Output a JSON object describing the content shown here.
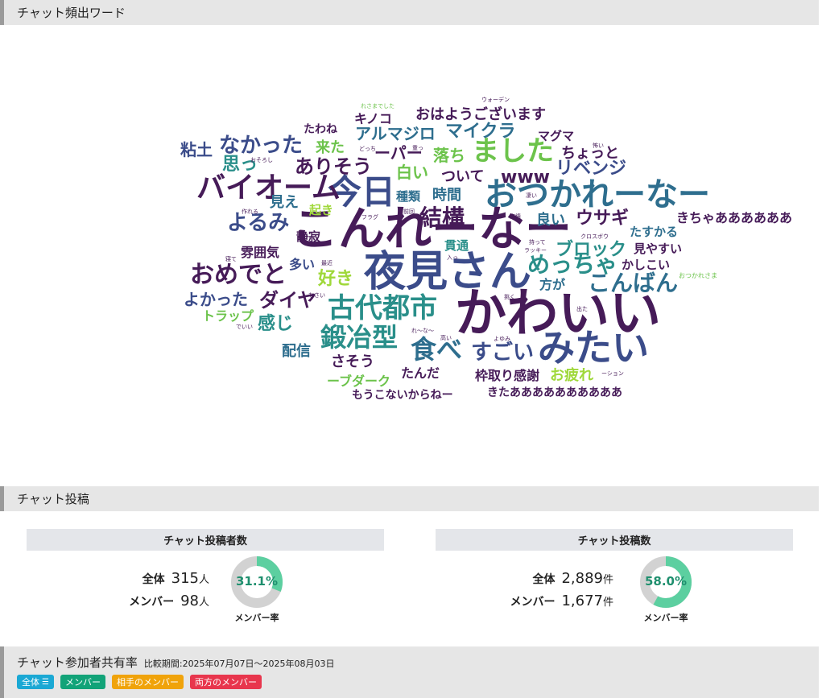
{
  "wordcloud_section": {
    "title": "チャット頻出ワード",
    "words": [
      {
        "text": "かわいい",
        "color": "#461b58"
      },
      {
        "text": "こんれーなー",
        "color": "#461b58"
      },
      {
        "text": "夜見さん",
        "color": "#3b4c8a"
      },
      {
        "text": "おつかれーなー",
        "color": "#2e6e8e"
      },
      {
        "text": "今日",
        "color": "#3b4c8a"
      },
      {
        "text": "みたい",
        "color": "#3b4c8a"
      },
      {
        "text": "古代都市",
        "color": "#2a8f8a"
      },
      {
        "text": "バイオーム",
        "color": "#461b58"
      },
      {
        "text": "ました",
        "color": "#6cc34b"
      },
      {
        "text": "鍛冶型",
        "color": "#2a8f8a"
      },
      {
        "text": "食べ",
        "color": "#2e6e8e"
      },
      {
        "text": "おめでと",
        "color": "#461b58"
      },
      {
        "text": "結構",
        "color": "#461b58"
      },
      {
        "text": "めっちゃ",
        "color": "#2a8f8a"
      },
      {
        "text": "こんばん",
        "color": "#2e6e8e"
      },
      {
        "text": "すごい",
        "color": "#3b4c8a"
      },
      {
        "text": "なかった",
        "color": "#3b4c8a"
      },
      {
        "text": "よるみ",
        "color": "#3b4c8a"
      },
      {
        "text": "ありそう",
        "color": "#461b58"
      },
      {
        "text": "ダイヤ",
        "color": "#461b58"
      },
      {
        "text": "ブロック",
        "color": "#2a8f8a"
      },
      {
        "text": "リベンジ",
        "color": "#3b4c8a"
      },
      {
        "text": "ウサギ",
        "color": "#461b58"
      },
      {
        "text": "マイクラ",
        "color": "#2e6e8e"
      },
      {
        "text": "アルマジロ",
        "color": "#2e6e8e"
      },
      {
        "text": "おはようございます",
        "color": "#461b58"
      },
      {
        "text": "きちゃああああああ",
        "color": "#461b58"
      },
      {
        "text": "よかった",
        "color": "#3b4c8a"
      },
      {
        "text": "思っ",
        "color": "#2a8f8a"
      },
      {
        "text": "白い",
        "color": "#6cc34b"
      },
      {
        "text": "落ち",
        "color": "#6cc34b"
      },
      {
        "text": "ついて",
        "color": "#461b58"
      },
      {
        "text": "www",
        "color": "#461b58"
      },
      {
        "text": "粘土",
        "color": "#3b4c8a"
      },
      {
        "text": "来た",
        "color": "#6cc34b"
      },
      {
        "text": "ーパー",
        "color": "#461b58"
      },
      {
        "text": "ちょっと",
        "color": "#461b58"
      },
      {
        "text": "時間",
        "color": "#2e6e8e"
      },
      {
        "text": "見え",
        "color": "#2e6e8e"
      },
      {
        "text": "良い",
        "color": "#2e6e8e"
      },
      {
        "text": "好き",
        "color": "#9fd83a"
      },
      {
        "text": "雰囲気",
        "color": "#461b58"
      },
      {
        "text": "感じ",
        "color": "#2a8f8a"
      },
      {
        "text": "配信",
        "color": "#2e6e8e"
      },
      {
        "text": "さそう",
        "color": "#461b58"
      },
      {
        "text": "お疲れ",
        "color": "#9fd83a"
      },
      {
        "text": "枠取り感謝",
        "color": "#461b58"
      },
      {
        "text": "きたああああああああああ",
        "color": "#461b58"
      },
      {
        "text": "もうこないからねー",
        "color": "#461b58"
      },
      {
        "text": "ーブダーク",
        "color": "#6cc34b"
      },
      {
        "text": "たんだ",
        "color": "#461b58"
      },
      {
        "text": "トラップ",
        "color": "#6cc34b"
      },
      {
        "text": "多い",
        "color": "#3b4c8a"
      },
      {
        "text": "静寂",
        "color": "#461b58"
      },
      {
        "text": "貫通",
        "color": "#2a8f8a"
      },
      {
        "text": "方が",
        "color": "#2e6e8e"
      },
      {
        "text": "かしこい",
        "color": "#461b58"
      },
      {
        "text": "見やすい",
        "color": "#461b58"
      },
      {
        "text": "たすかる",
        "color": "#2e6e8e"
      },
      {
        "text": "マグマ",
        "color": "#461b58"
      },
      {
        "text": "キノコ",
        "color": "#461b58"
      },
      {
        "text": "たわね",
        "color": "#461b58"
      },
      {
        "text": "種類",
        "color": "#2e6e8e"
      },
      {
        "text": "起き",
        "color": "#9fd83a"
      },
      {
        "text": "おつかれさま",
        "color": "#6cc34b"
      },
      {
        "text": "れさまでした",
        "color": "#6cc34b"
      },
      {
        "text": "ウォーデン",
        "color": "#461b58"
      },
      {
        "text": "クロスボウ",
        "color": "#461b58"
      },
      {
        "text": "ラッキー",
        "color": "#461b58"
      },
      {
        "text": "持って",
        "color": "#461b58"
      },
      {
        "text": "ーション",
        "color": "#461b58"
      },
      {
        "text": "れ〜な〜",
        "color": "#461b58"
      },
      {
        "text": "前回",
        "color": "#461b58"
      },
      {
        "text": "フラグ",
        "color": "#461b58"
      },
      {
        "text": "作れる",
        "color": "#461b58"
      },
      {
        "text": "おそろし",
        "color": "#461b58"
      },
      {
        "text": "どっち",
        "color": "#461b58"
      },
      {
        "text": "重っ",
        "color": "#461b58"
      },
      {
        "text": "実績",
        "color": "#461b58"
      },
      {
        "text": "怖い",
        "color": "#461b58"
      },
      {
        "text": "凄い",
        "color": "#461b58"
      },
      {
        "text": "寝て",
        "color": "#461b58"
      },
      {
        "text": "最近",
        "color": "#461b58"
      },
      {
        "text": "入っ",
        "color": "#461b58"
      },
      {
        "text": "なさい",
        "color": "#461b58"
      },
      {
        "text": "でいい",
        "color": "#461b58"
      },
      {
        "text": "挑く",
        "color": "#461b58"
      },
      {
        "text": "出た",
        "color": "#461b58"
      },
      {
        "text": "高い",
        "color": "#461b58"
      },
      {
        "text": "よゆみ",
        "color": "#461b58"
      }
    ]
  },
  "posts_section": {
    "title": "チャット投稿",
    "posters": {
      "header": "チャット投稿者数",
      "total_label": "全体",
      "total_value": "315",
      "member_label": "メンバー",
      "member_value": "98",
      "unit": "人",
      "member_rate": 0.311,
      "member_rate_text": "31.1%",
      "caption": "メンバー率"
    },
    "posts": {
      "header": "チャット投稿数",
      "total_label": "全体",
      "total_value": "2,889",
      "member_label": "メンバー",
      "member_value": "1,677",
      "unit": "件",
      "member_rate": 0.58,
      "member_rate_text": "58.0%",
      "caption": "メンバー率"
    },
    "colors": {
      "accent": "#5ccfa0",
      "track": "#d2d2d2",
      "pct_text": "#1f8f6e"
    }
  },
  "share_section": {
    "title": "チャット参加者共有率",
    "period": "比較期間:2025年07月07日〜2025年08月03日",
    "legend": [
      {
        "label": "全体",
        "color": "#1aa8d4",
        "icon": "list-icon"
      },
      {
        "label": "メンバー",
        "color": "#12a378"
      },
      {
        "label": "相手のメンバー",
        "color": "#f0a30a"
      },
      {
        "label": "両方のメンバー",
        "color": "#e8364d"
      }
    ]
  }
}
